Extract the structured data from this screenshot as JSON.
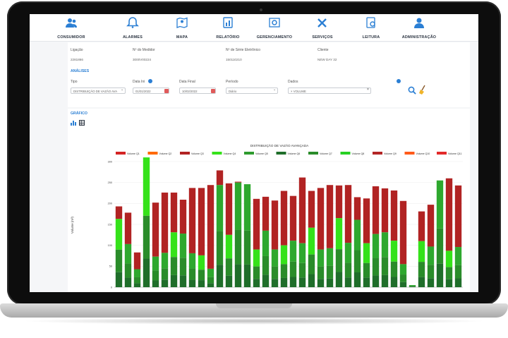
{
  "nav": [
    {
      "label": "CONSUMIDOR",
      "icon": "users-icon"
    },
    {
      "label": "ALARMES",
      "icon": "bell-icon"
    },
    {
      "label": "MAPA",
      "icon": "map-pin-icon"
    },
    {
      "label": "RELATÓRIO",
      "icon": "report-icon"
    },
    {
      "label": "GERENCIAMENTO",
      "icon": "gears-icon"
    },
    {
      "label": "SERVIÇOS",
      "icon": "tools-icon"
    },
    {
      "label": "LEITURA",
      "icon": "reading-icon"
    },
    {
      "label": "ADMINISTRAÇÃO",
      "icon": "admin-icon"
    }
  ],
  "info": {
    "ligacao_label": "Ligação",
    "ligacao_value": "2281866",
    "medidor_label": "Nº do Medidor",
    "medidor_value": "3000V00224",
    "serie_label": "Nº de Série Eletrônico",
    "serie_value": "150110210",
    "cliente_label": "Cliente",
    "cliente_value": "NEW DAY 32"
  },
  "analises": {
    "title": "ANÁLISES",
    "tipo_label": "Tipo",
    "tipo_value": "DISTRIBUIÇÃO DE VAZÃO AVA",
    "data_ini_label": "Data Ini",
    "data_ini_value": "01/01/2022",
    "data_fim_label": "Data Final",
    "data_fim_value": "10/02/2022",
    "periodo_label": "Período",
    "periodo_value": "Diário",
    "dados_label": "Dados",
    "dados_value": "× VOLUME"
  },
  "grafico": {
    "title": "GRÁFICO"
  },
  "chart_data": {
    "type": "bar",
    "stacked": true,
    "title": "DISTRIBUIÇÃO DE VAZÃO AVANÇADA",
    "ylabel": "Volume (m³)",
    "xlabel": "",
    "ylim": [
      0,
      300
    ],
    "yticks": [
      0,
      50,
      100,
      150,
      200,
      250,
      300
    ],
    "legend_position": "top",
    "series_names": [
      "Volume Q1",
      "Volume Q2",
      "Volume Q3",
      "Volume Q4",
      "Volume Q5",
      "Volume Q6",
      "Volume Q7",
      "Volume Q8",
      "Volume Q9",
      "Volume Q10",
      "Volume Q11"
    ],
    "series_colors": [
      "#d42424",
      "#ff6a00",
      "#b12323",
      "#35e21a",
      "#2e9b2e",
      "#1f6e2a",
      "#2a8c2a",
      "#27d022",
      "#b32626",
      "#ff5a1a",
      "#e22a2a"
    ],
    "totals": [
      193,
      178,
      83,
      310,
      202,
      226,
      226,
      209,
      237,
      237,
      244,
      279,
      248,
      252,
      246,
      211,
      216,
      207,
      230,
      218,
      262,
      230,
      237,
      244,
      243,
      244,
      215,
      212,
      241,
      236,
      231,
      206,
      5,
      181,
      197,
      255,
      260,
      243
    ],
    "green_tops": [
      163,
      103,
      43,
      310,
      73,
      82,
      131,
      128,
      81,
      76,
      44,
      244,
      125,
      250,
      246,
      90,
      135,
      90,
      100,
      111,
      105,
      142,
      90,
      93,
      165,
      106,
      161,
      105,
      127,
      131,
      111,
      55,
      5,
      110,
      97,
      255,
      87,
      96
    ]
  }
}
